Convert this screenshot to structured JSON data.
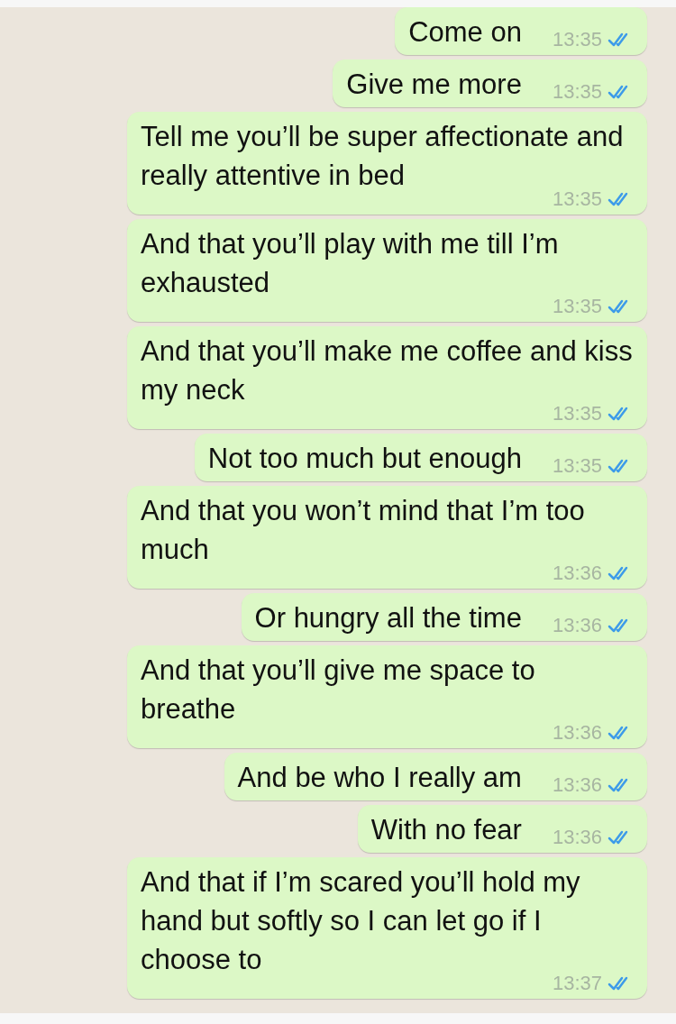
{
  "messages": [
    {
      "text": "Come on",
      "time": "13:35",
      "read": true
    },
    {
      "text": "Give me more",
      "time": "13:35",
      "read": true
    },
    {
      "text": "Tell me you’ll be super affectionate and really attentive in bed",
      "time": "13:35",
      "read": true
    },
    {
      "text": "And that you’ll play with me till I’m exhausted",
      "time": "13:35",
      "read": true
    },
    {
      "text": "And that you’ll make me coffee and kiss my neck",
      "time": "13:35",
      "read": true
    },
    {
      "text": "Not too much but enough",
      "time": "13:35",
      "read": true
    },
    {
      "text": "And that you won’t mind that I’m too much",
      "time": "13:36",
      "read": true
    },
    {
      "text": "Or hungry all the time",
      "time": "13:36",
      "read": true
    },
    {
      "text": "And that you’ll give me space to breathe",
      "time": "13:36",
      "read": true
    },
    {
      "text": "And be who I really am",
      "time": "13:36",
      "read": true
    },
    {
      "text": "With no fear",
      "time": "13:36",
      "read": true
    },
    {
      "text": "And that if I’m scared you’ll hold my hand but softly so I can let go if I choose to",
      "time": "13:37",
      "read": true
    }
  ]
}
